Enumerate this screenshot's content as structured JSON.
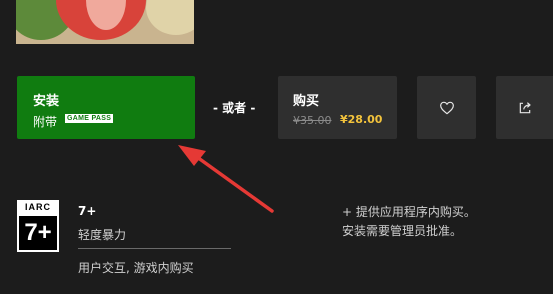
{
  "install": {
    "title": "安装",
    "subtitle": "附带",
    "badge": "GAME PASS"
  },
  "separator": "- 或者 -",
  "buy": {
    "title": "购买",
    "old_price": "¥35.00",
    "new_price": "¥28.00"
  },
  "icons": {
    "wishlist": "heart-icon",
    "share": "share-icon"
  },
  "rating": {
    "org": "IARC",
    "age_badge": "7+",
    "age_title": "7+",
    "descriptor": "轻度暴力",
    "interactive": "用户交互, 游戏内购买"
  },
  "notes": {
    "line1": "+ 提供应用程序内购买。",
    "line2": "安装需要管理员批准。"
  },
  "colors": {
    "install_bg": "#107c10",
    "price_accent": "#f3c33c",
    "arrow": "#e53935"
  }
}
